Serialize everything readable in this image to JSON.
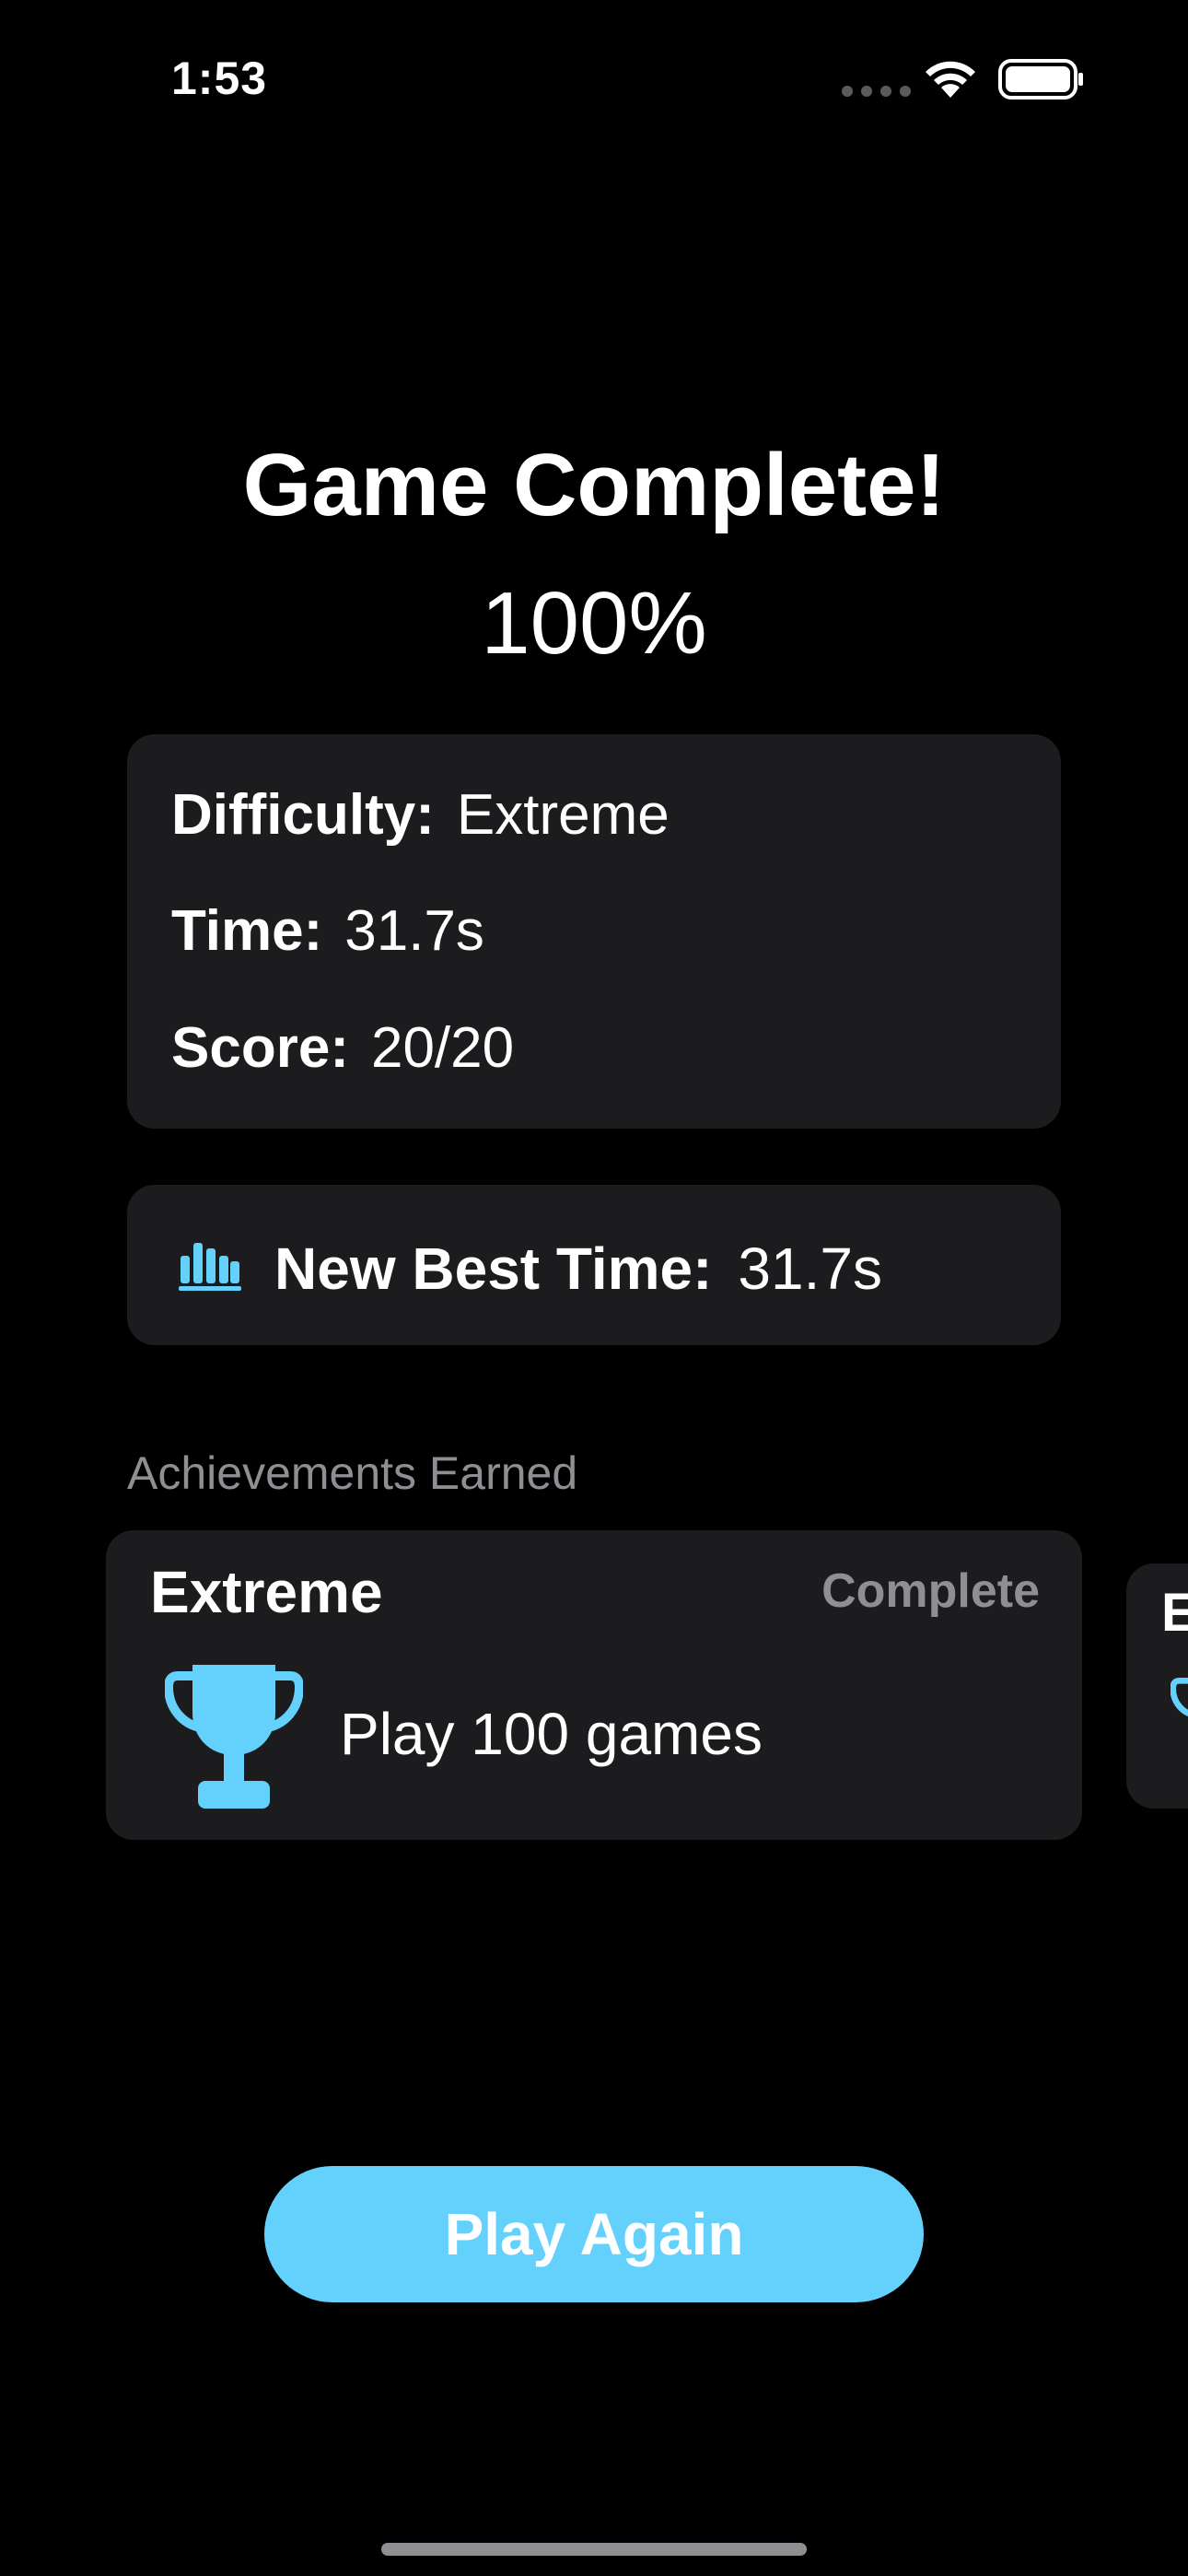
{
  "status_bar": {
    "time": "1:53",
    "icons": [
      "cellular-icon",
      "wifi-icon",
      "battery-icon"
    ]
  },
  "header": {
    "title": "Game Complete!",
    "percent": "100%"
  },
  "stats": {
    "difficulty_label": "Difficulty:",
    "difficulty_value": "Extreme",
    "time_label": "Time:",
    "time_value": "31.7s",
    "score_label": "Score:",
    "score_value": "20/20"
  },
  "best": {
    "icon": "chart-bar-icon",
    "label": "New Best Time:",
    "value": "31.7s"
  },
  "achievements": {
    "section_label": "Achievements Earned",
    "items": [
      {
        "title": "Extreme",
        "status": "Complete",
        "description": "Play 100 games",
        "icon": "trophy-icon"
      },
      {
        "title": "E",
        "icon": "trophy-icon"
      }
    ]
  },
  "actions": {
    "play_again": "Play Again"
  },
  "colors": {
    "background": "#000000",
    "card": "#1c1c1e",
    "accent": "#64d0fc",
    "secondary_text": "#8e8e93"
  }
}
